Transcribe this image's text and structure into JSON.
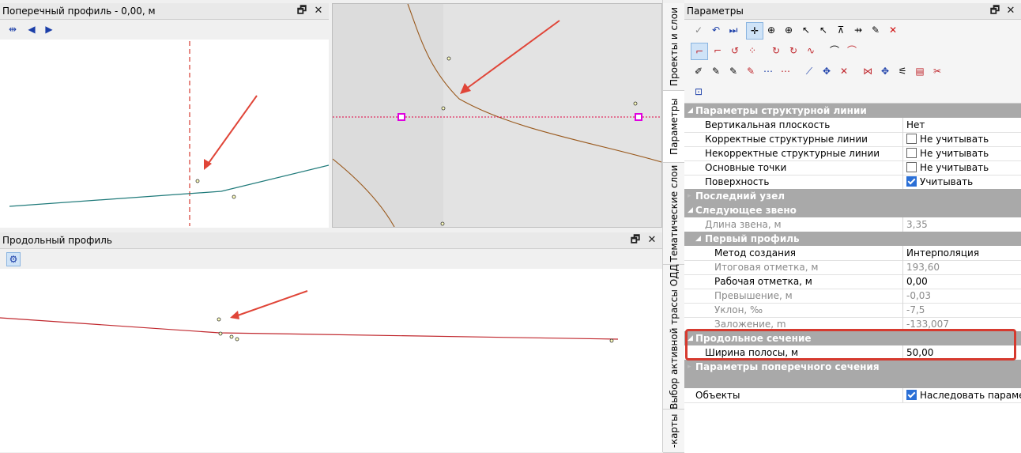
{
  "cross_profile": {
    "title": "Поперечный профиль - 0,00, м"
  },
  "long_profile": {
    "title": "Продольный профиль"
  },
  "params": {
    "title": "Параметры",
    "sections": {
      "structural_line": "Параметры структурной линии",
      "last_node": "Последний узел",
      "next_link": "Следующее звено",
      "first_profile": "Первый профиль",
      "long_section": "Продольное сечение",
      "cross_section": "Параметры поперечного сечения"
    },
    "rows": {
      "vertical_plane": {
        "label": "Вертикальная плоскость",
        "value": "Нет"
      },
      "correct_lines": {
        "label": "Корректные структурные линии",
        "value": "Не учитывать"
      },
      "incorrect_lines": {
        "label": "Некорректные структурные линии",
        "value": "Не учитывать"
      },
      "main_points": {
        "label": "Основные точки",
        "value": "Не учитывать"
      },
      "surface": {
        "label": "Поверхность",
        "value": "Учитывать"
      },
      "link_length": {
        "label": "Длина звена, м",
        "value": "3,35"
      },
      "creation_method": {
        "label": "Метод создания",
        "value": "Интерполяция"
      },
      "final_mark": {
        "label": "Итоговая отметка, м",
        "value": "193,60"
      },
      "working_mark": {
        "label": "Рабочая отметка, м",
        "value": "0,00"
      },
      "excess": {
        "label": "Превышение, м",
        "value": "-0,03"
      },
      "slope": {
        "label": "Уклон, ‰",
        "value": "-7,5"
      },
      "bedding": {
        "label": "Заложение, m",
        "value": "-133,007"
      },
      "strip_width": {
        "label": "Ширина полосы, м",
        "value": "50,00"
      },
      "objects": {
        "label": "Объекты",
        "value": "Наследовать параметры"
      }
    }
  },
  "side_tabs": {
    "projects": "Проекты и слои",
    "params": "Параметры",
    "thematic": "Тематические слои",
    "route": "Выбор активной трассы ОДД",
    "maps": "-карты"
  },
  "colors": {
    "accent": "#1b3ea8",
    "highlight": "#d63a2f",
    "profile_line_cross": "#1f7a7a",
    "profile_line_long": "#c0272d",
    "map_line": "#9a5a1e",
    "magenta": "#e000e0"
  }
}
